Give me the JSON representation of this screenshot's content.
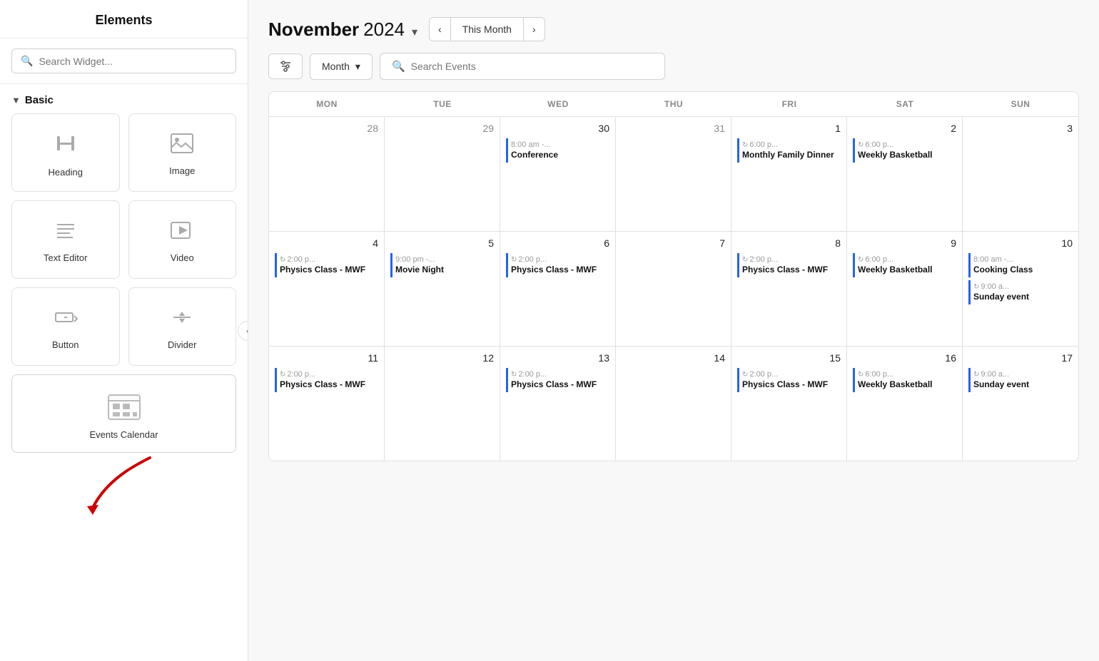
{
  "sidebar": {
    "title": "Elements",
    "search_placeholder": "Search Widget...",
    "section_basic": "Basic",
    "widgets": [
      {
        "id": "heading",
        "label": "Heading",
        "icon": "T"
      },
      {
        "id": "image",
        "label": "Image",
        "icon": "IMG"
      },
      {
        "id": "text-editor",
        "label": "Text Editor",
        "icon": "TXT"
      },
      {
        "id": "video",
        "label": "Video",
        "icon": "VID"
      },
      {
        "id": "button",
        "label": "Button",
        "icon": "BTN"
      },
      {
        "id": "divider",
        "label": "Divider",
        "icon": "DIV"
      },
      {
        "id": "events-calendar",
        "label": "Events Calendar",
        "icon": "CAL"
      }
    ]
  },
  "calendar": {
    "title_month": "November",
    "title_year": "2024",
    "this_month_label": "This Month",
    "view_label": "Month",
    "search_placeholder": "Search Events",
    "day_headers": [
      "MON",
      "TUE",
      "WED",
      "THU",
      "FRI",
      "SAT",
      "SUN"
    ],
    "weeks": [
      {
        "days": [
          {
            "date": "28",
            "current": false,
            "events": []
          },
          {
            "date": "29",
            "current": false,
            "events": []
          },
          {
            "date": "30",
            "current": false,
            "events": [
              {
                "time": "8:00 am -...",
                "title": "Conference",
                "recurring": false,
                "color": "blue"
              }
            ]
          },
          {
            "date": "31",
            "current": false,
            "events": []
          },
          {
            "date": "1",
            "current": true,
            "events": [
              {
                "time": "6:00 p...",
                "title": "Monthly Family Dinner",
                "recurring": true,
                "color": "blue"
              }
            ]
          },
          {
            "date": "2",
            "current": true,
            "events": [
              {
                "time": "6:00 p...",
                "title": "Weekly Basketball",
                "recurring": true,
                "color": "blue"
              }
            ]
          },
          {
            "date": "3",
            "current": true,
            "events": []
          }
        ]
      },
      {
        "days": [
          {
            "date": "4",
            "current": true,
            "events": [
              {
                "time": "2:00 p...",
                "title": "Physics Class - MWF",
                "recurring": true,
                "color": "blue"
              }
            ]
          },
          {
            "date": "5",
            "current": true,
            "events": [
              {
                "time": "9:00 pm -...",
                "title": "Movie Night",
                "recurring": false,
                "color": "blue"
              }
            ]
          },
          {
            "date": "6",
            "current": true,
            "events": [
              {
                "time": "2:00 p...",
                "title": "Physics Class - MWF",
                "recurring": true,
                "color": "blue"
              }
            ]
          },
          {
            "date": "7",
            "current": true,
            "events": []
          },
          {
            "date": "8",
            "current": true,
            "events": [
              {
                "time": "2:00 p...",
                "title": "Physics Class - MWF",
                "recurring": true,
                "color": "blue"
              }
            ]
          },
          {
            "date": "9",
            "current": true,
            "events": [
              {
                "time": "6:00 p...",
                "title": "Weekly Basketball",
                "recurring": true,
                "color": "blue"
              }
            ]
          },
          {
            "date": "10",
            "current": true,
            "events": [
              {
                "time": "8:00 am -...",
                "title": "Cooking Class",
                "recurring": false,
                "color": "blue"
              },
              {
                "time": "9:00 a...",
                "title": "Sunday event",
                "recurring": true,
                "color": "blue"
              }
            ]
          }
        ]
      },
      {
        "days": [
          {
            "date": "11",
            "current": true,
            "events": [
              {
                "time": "2:00 p...",
                "title": "Physics Class - MWF",
                "recurring": true,
                "color": "blue"
              }
            ]
          },
          {
            "date": "12",
            "current": true,
            "events": []
          },
          {
            "date": "13",
            "current": true,
            "events": [
              {
                "time": "2:00 p...",
                "title": "Physics Class - MWF",
                "recurring": true,
                "color": "blue"
              }
            ]
          },
          {
            "date": "14",
            "current": true,
            "events": []
          },
          {
            "date": "15",
            "current": true,
            "events": [
              {
                "time": "2:00 p...",
                "title": "Physics Class - MWF",
                "recurring": true,
                "color": "blue"
              }
            ]
          },
          {
            "date": "16",
            "current": true,
            "events": [
              {
                "time": "6:00 p...",
                "title": "Weekly Basketball",
                "recurring": true,
                "color": "blue"
              }
            ]
          },
          {
            "date": "17",
            "current": true,
            "events": [
              {
                "time": "9:00 a...",
                "title": "Sunday event",
                "recurring": true,
                "color": "blue"
              }
            ]
          }
        ]
      }
    ]
  }
}
